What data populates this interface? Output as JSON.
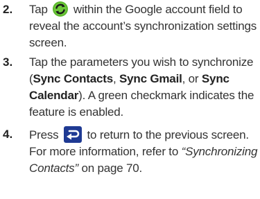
{
  "steps": [
    {
      "number": "2.",
      "before_icon": "Tap",
      "icon": "sync-icon",
      "after_icon": "within the Google account field to reveal the account’s synchronization settings screen."
    },
    {
      "number": "3.",
      "text_1": "Tap the parameters you wish to synchronize (",
      "opt_1": "Sync Contacts",
      "sep_1": ", ",
      "opt_2": "Sync Gmail",
      "sep_2": ", or ",
      "opt_3": "Sync Calendar",
      "text_2": "). A green checkmark indicates the feature is enabled."
    },
    {
      "number": "4.",
      "before_icon": "Press",
      "icon": "back-icon",
      "after_icon": "to return to the previous screen. For more information, refer to ",
      "ref_link": "“Synchronizing Contacts”",
      "after_link": " on page 70."
    }
  ],
  "colors": {
    "sync_icon_green": "#5cb82e",
    "back_icon_blue": "#1f3a93"
  }
}
